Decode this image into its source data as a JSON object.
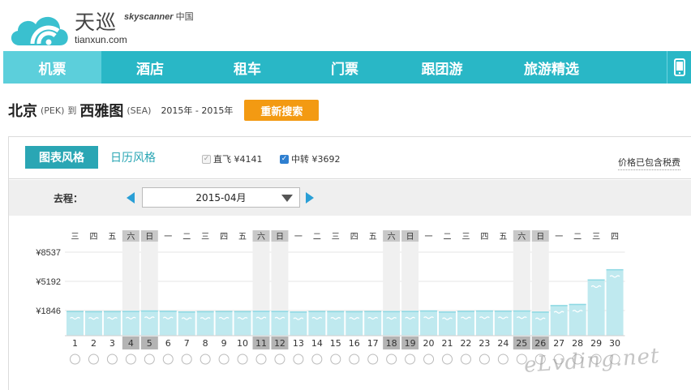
{
  "brand": {
    "name_cn": "天巡",
    "partner_prefix": "skyscanner",
    "partner_suffix": "中国",
    "domain": "tianxun.com",
    "accent": "#29b7c6",
    "icon": "cloud-wifi-logo"
  },
  "nav": {
    "items": [
      {
        "label": "机票",
        "active": true
      },
      {
        "label": "酒店",
        "active": false
      },
      {
        "label": "租车",
        "active": false
      },
      {
        "label": "门票",
        "active": false
      },
      {
        "label": "跟团游",
        "active": false
      },
      {
        "label": "旅游精选",
        "active": false
      }
    ],
    "phone_icon": "mobile-phone-icon"
  },
  "route": {
    "origin": "北京",
    "origin_code": "(PEK)",
    "to": "到",
    "destination": "西雅图",
    "destination_code": "(SEA)",
    "dates": "2015年 - 2015年",
    "research_label": "重新搜索"
  },
  "toolbar": {
    "tab_chart": "图表风格",
    "tab_calendar": "日历风格",
    "direct_label": "直飞 ¥4141",
    "direct_checked": false,
    "transfer_label": "中转 ¥3692",
    "transfer_checked": true,
    "tax_note": "价格已包含税费"
  },
  "selector": {
    "label": "去程：",
    "month": "2015-04月"
  },
  "watermark": "eLvding.net",
  "chart_data": {
    "type": "bar",
    "title": "",
    "xlabel": "",
    "ylabel": "",
    "y_ticks": [
      1846,
      5192,
      8537
    ],
    "y_tick_labels": [
      "¥1846",
      "¥5192",
      "¥8537"
    ],
    "weekdays": [
      "三",
      "四",
      "五",
      "六",
      "日",
      "一",
      "二",
      "三",
      "四",
      "五",
      "六",
      "日",
      "一",
      "二",
      "三",
      "四",
      "五",
      "六",
      "日",
      "一",
      "二",
      "三",
      "四",
      "五",
      "六",
      "日",
      "一",
      "二",
      "三",
      "四"
    ],
    "weekend_days": [
      4,
      5,
      11,
      12,
      18,
      19,
      25,
      26
    ],
    "categories": [
      "1",
      "2",
      "3",
      "4",
      "5",
      "6",
      "7",
      "8",
      "9",
      "10",
      "11",
      "12",
      "13",
      "14",
      "15",
      "16",
      "17",
      "18",
      "19",
      "20",
      "21",
      "22",
      "23",
      "24",
      "25",
      "26",
      "27",
      "28",
      "29",
      "30"
    ],
    "values": [
      1800,
      1780,
      1790,
      1810,
      1860,
      1820,
      1750,
      1780,
      1800,
      1790,
      1820,
      1810,
      1740,
      1800,
      1790,
      1780,
      1800,
      1790,
      1810,
      1860,
      1740,
      1820,
      1860,
      1840,
      1860,
      1730,
      2480,
      2610,
      5420,
      6590
    ],
    "colors": {
      "bar": "#bfe9ef",
      "bar_top": "#8ed9e3",
      "weekend_header": "#c8c8c8",
      "weekend_column": "#f0f0f0",
      "weekend_label": "#b4b4b4"
    }
  }
}
